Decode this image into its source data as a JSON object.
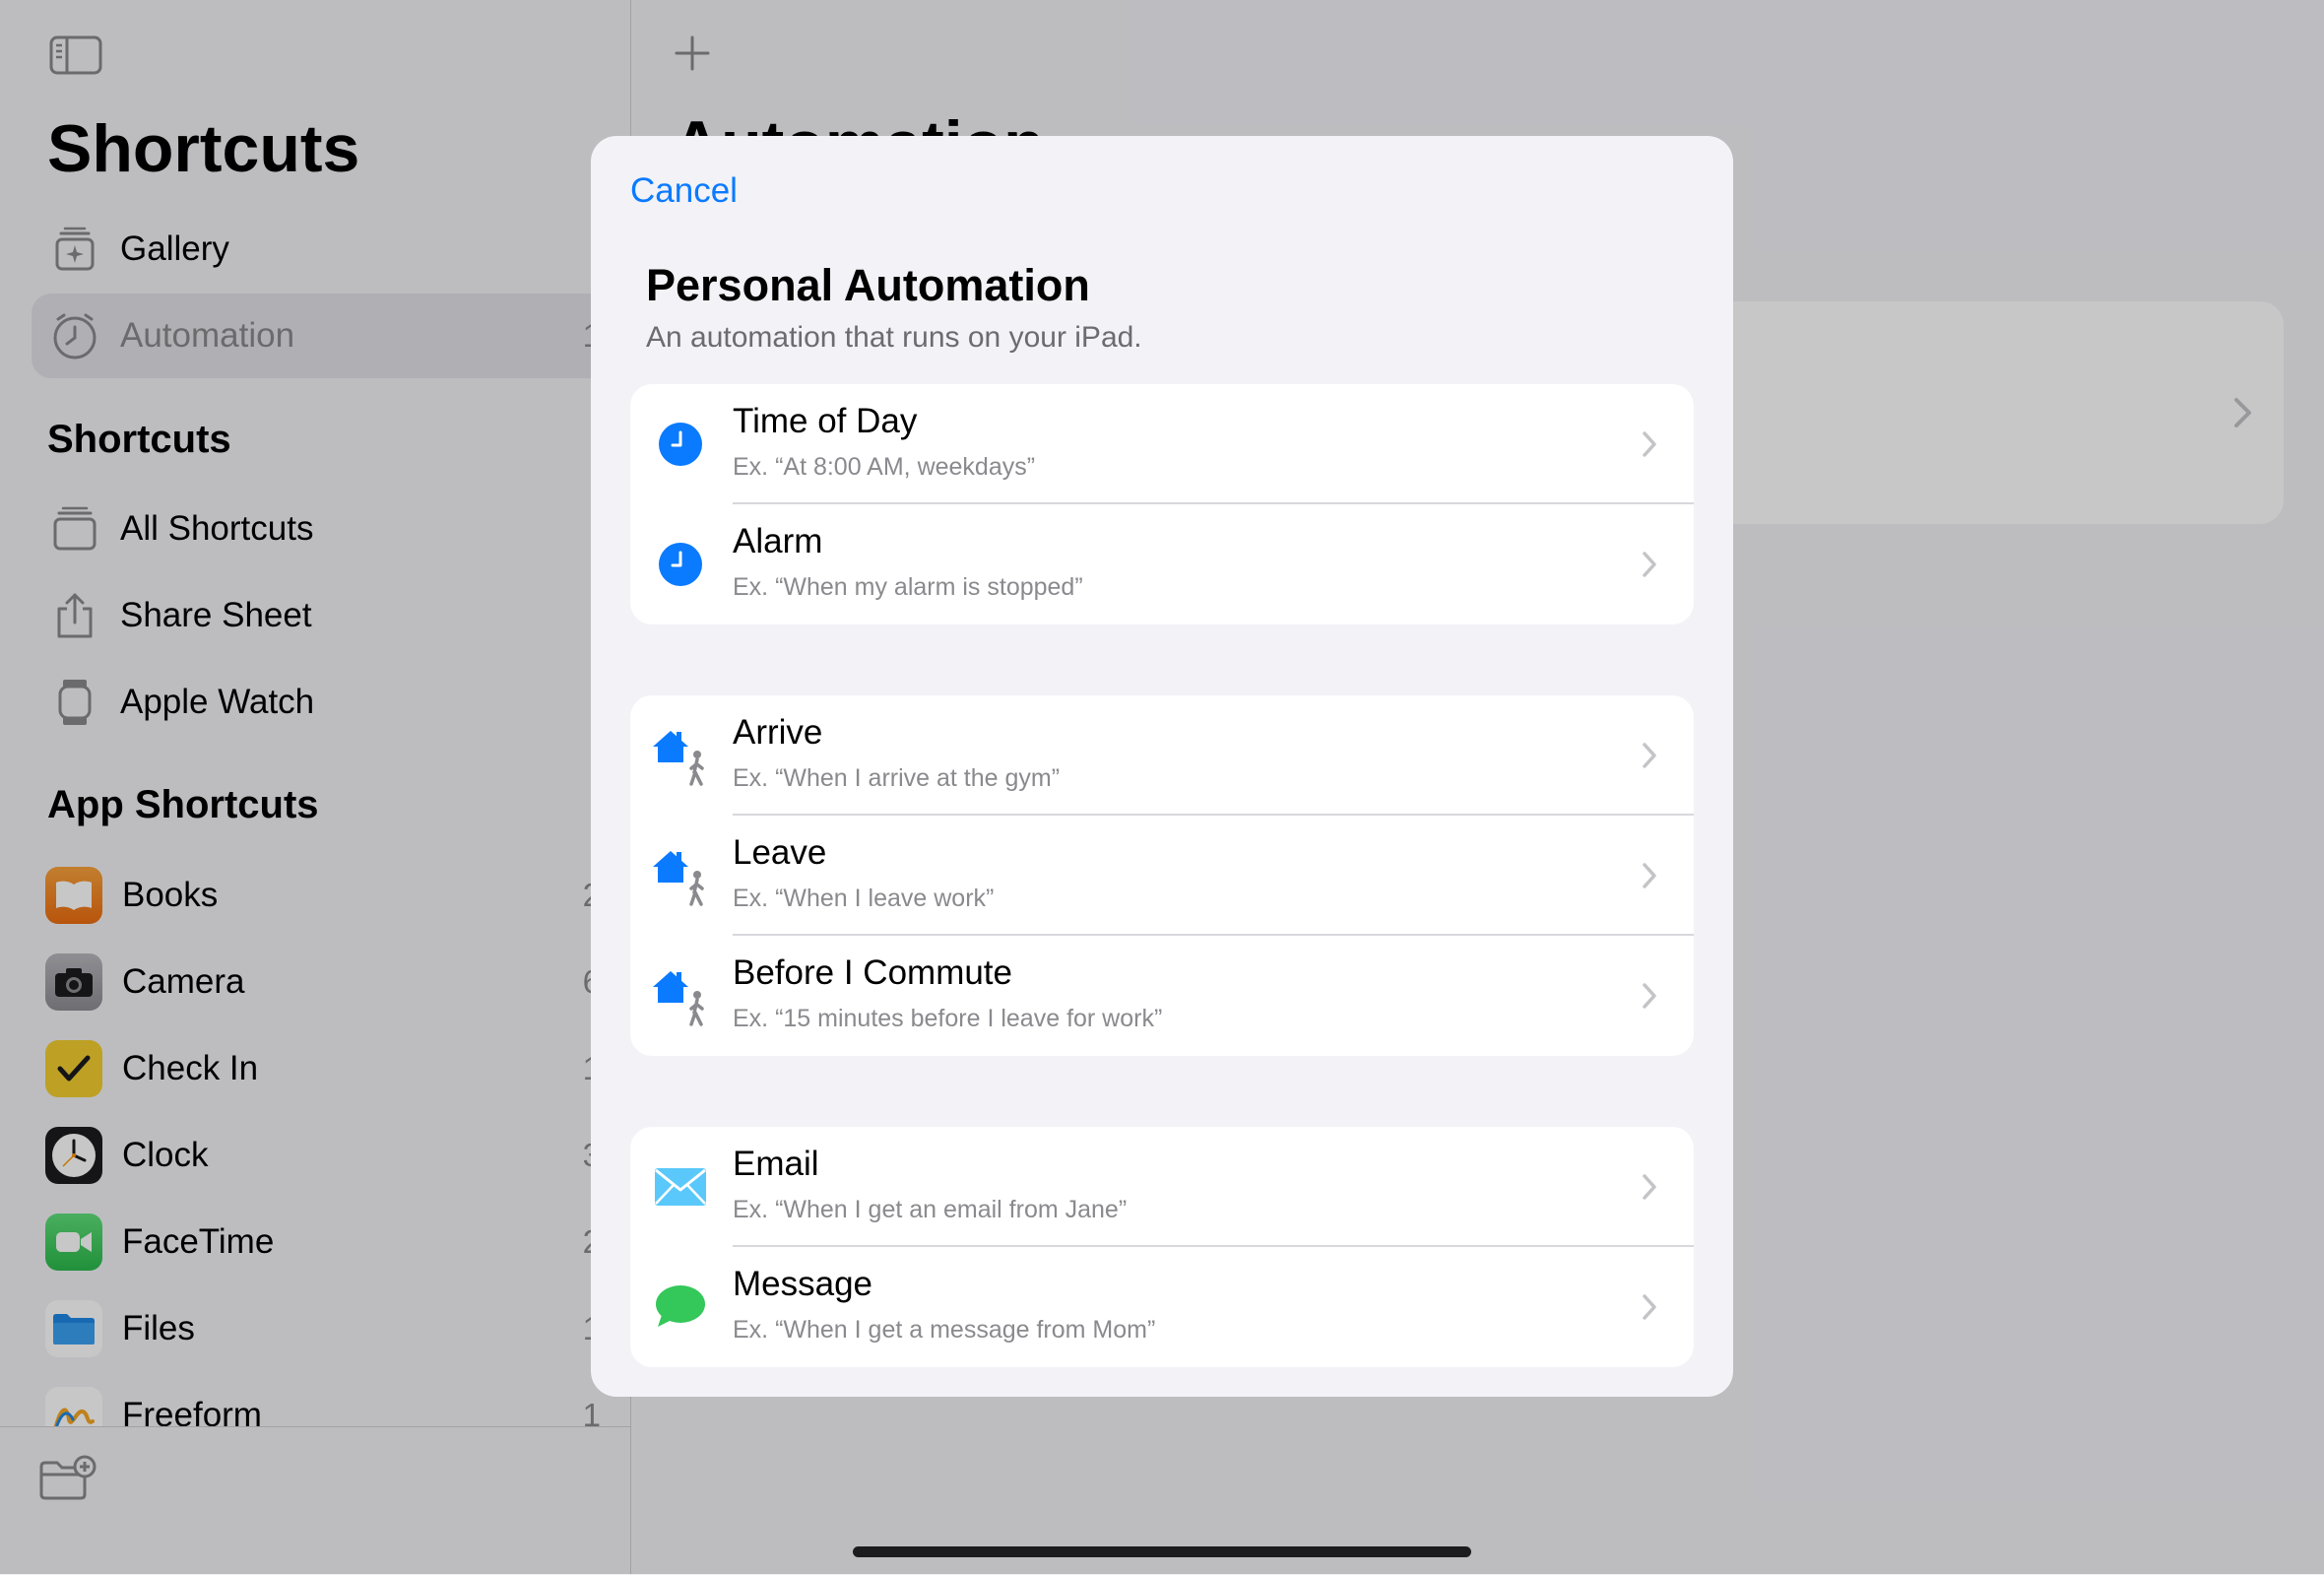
{
  "sidebar": {
    "title": "Shortcuts",
    "top_items": [
      {
        "label": "Gallery",
        "icon": "gallery-icon"
      },
      {
        "label": "Automation",
        "icon": "clock-icon",
        "count": "1",
        "selected": true
      }
    ],
    "shortcuts_header": "Shortcuts",
    "shortcuts_items": [
      {
        "label": "All Shortcuts",
        "icon": "stack-icon"
      },
      {
        "label": "Share Sheet",
        "icon": "share-icon"
      },
      {
        "label": "Apple Watch",
        "icon": "watch-icon"
      }
    ],
    "apps_header": "App Shortcuts",
    "apps": [
      {
        "label": "Books",
        "count": "2",
        "icon": "books-icon",
        "color": "#f7821b"
      },
      {
        "label": "Camera",
        "count": "6",
        "icon": "camera-icon",
        "color": "#8e8e93"
      },
      {
        "label": "Check In",
        "count": "1",
        "icon": "checkmark-icon",
        "color": "#ffd60a"
      },
      {
        "label": "Clock",
        "count": "3",
        "icon": "clock-face-icon",
        "color": "#1c1c1e"
      },
      {
        "label": "FaceTime",
        "count": "2",
        "icon": "video-icon",
        "color": "#34c759"
      },
      {
        "label": "Files",
        "count": "1",
        "icon": "folder-icon",
        "color": "#ffffff"
      },
      {
        "label": "Freeform",
        "count": "1",
        "icon": "freeform-icon",
        "color": "#ffffff"
      }
    ]
  },
  "main": {
    "title": "Automation"
  },
  "modal": {
    "cancel_label": "Cancel",
    "title": "Personal Automation",
    "subtitle": "An automation that runs on your iPad.",
    "groups": [
      [
        {
          "title": "Time of Day",
          "subtitle": "Ex. “At 8:00 AM, weekdays”",
          "icon": "clock-icon"
        },
        {
          "title": "Alarm",
          "subtitle": "Ex. “When my alarm is stopped”",
          "icon": "alarm-icon"
        }
      ],
      [
        {
          "title": "Arrive",
          "subtitle": "Ex. “When I arrive at the gym”",
          "icon": "home-walk-icon"
        },
        {
          "title": "Leave",
          "subtitle": "Ex. “When I leave work”",
          "icon": "home-walk-icon"
        },
        {
          "title": "Before I Commute",
          "subtitle": "Ex. “15 minutes before I leave for work”",
          "icon": "home-walk-icon"
        }
      ],
      [
        {
          "title": "Email",
          "subtitle": "Ex. “When I get an email from Jane”",
          "icon": "mail-icon"
        },
        {
          "title": "Message",
          "subtitle": "Ex. “When I get a message from Mom”",
          "icon": "message-icon"
        }
      ]
    ]
  },
  "colors": {
    "accent": "#0a7aff",
    "mail": "#5ac8fa",
    "message": "#34c759",
    "background": "#f2f2f7"
  }
}
